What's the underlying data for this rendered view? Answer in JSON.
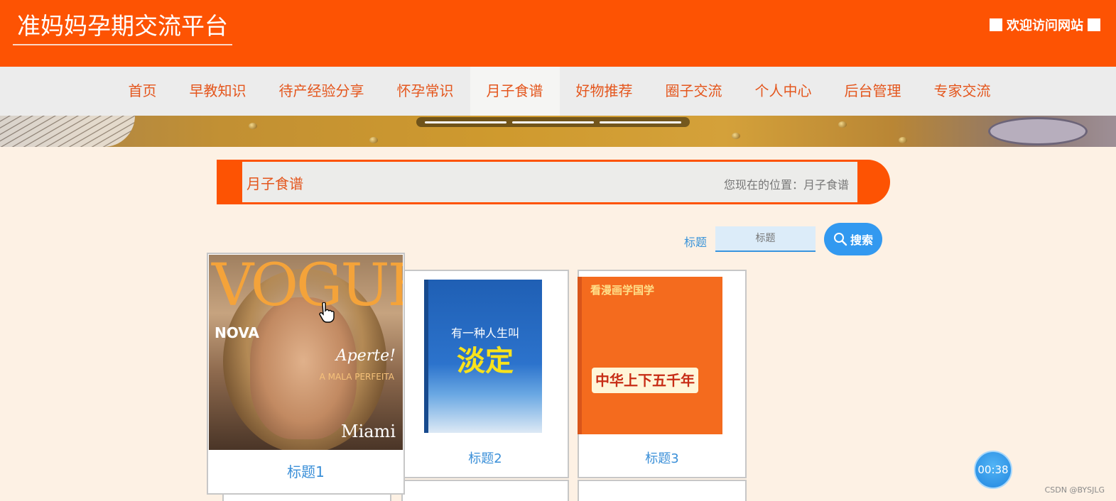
{
  "header": {
    "site_title": "准妈妈孕期交流平台",
    "welcome": "欢迎访问网站"
  },
  "nav": {
    "items": [
      {
        "label": "首页"
      },
      {
        "label": "早教知识"
      },
      {
        "label": "待产经验分享"
      },
      {
        "label": "怀孕常识"
      },
      {
        "label": "月子食谱",
        "active": true
      },
      {
        "label": "好物推荐"
      },
      {
        "label": "圈子交流"
      },
      {
        "label": "个人中心"
      },
      {
        "label": "后台管理"
      },
      {
        "label": "专家交流"
      }
    ]
  },
  "breadcrumb": {
    "title": "月子食谱",
    "location": "您现在的位置：月子食谱"
  },
  "search": {
    "label": "标题",
    "placeholder": "标题",
    "button_label": "搜索"
  },
  "cards": [
    {
      "caption": "标题1"
    },
    {
      "caption": "标题2"
    },
    {
      "caption": "标题3"
    }
  ],
  "timer": {
    "value": "00:38"
  },
  "watermark": "CSDN @BYSJLG",
  "colors": {
    "header_bg": "#fd5303",
    "nav_text": "#e4561d",
    "accent_blue": "#3299f0",
    "page_bg": "#fdf1e4"
  }
}
